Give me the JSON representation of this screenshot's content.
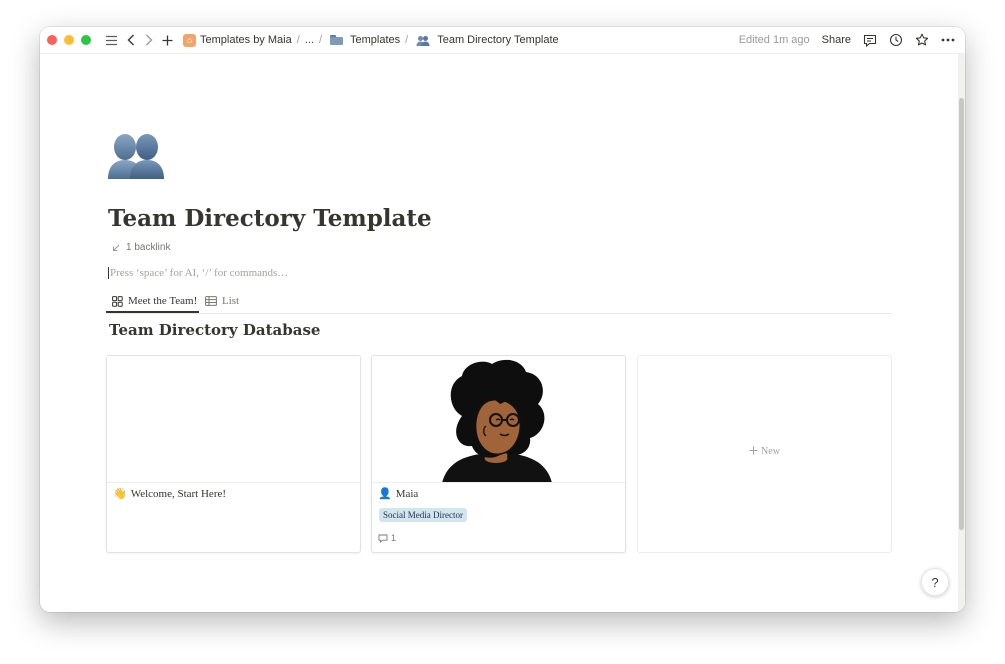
{
  "topbar": {
    "breadcrumbs": [
      {
        "label": "Templates by Maia",
        "icon": "house-emoji"
      },
      {
        "label": "..."
      },
      {
        "label": "Templates",
        "icon": "folder-icon"
      },
      {
        "label": "Team Directory Template",
        "icon": "busts-in-silhouette-emoji"
      }
    ],
    "edited": "Edited 1m ago",
    "share": "Share"
  },
  "page": {
    "icon": "busts-in-silhouette-emoji",
    "title": "Team Directory Template",
    "backlink": "1 backlink",
    "placeholder": "Press ‘space’ for AI, ‘/’ for commands…"
  },
  "views": {
    "tabs": [
      {
        "label": "Meet the Team!",
        "icon": "gallery-icon",
        "active": true
      },
      {
        "label": "List",
        "icon": "table-icon",
        "active": false
      }
    ]
  },
  "database": {
    "title": "Team Directory Database",
    "cards": [
      {
        "emoji": "👋",
        "name": "Welcome, Start Here!"
      },
      {
        "emoji": "👤",
        "name": "Maia",
        "tag": "Social Media Director",
        "comments": "1"
      }
    ],
    "new_label": "New"
  },
  "help": "?"
}
